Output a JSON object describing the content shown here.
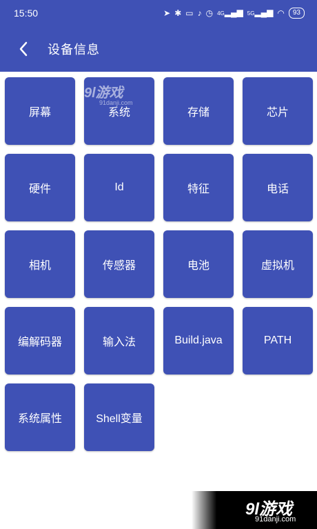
{
  "status_bar": {
    "time": "15:50",
    "signal_1": "4G",
    "signal_2": "5G",
    "battery": "93"
  },
  "toolbar": {
    "title": "设备信息"
  },
  "tiles": [
    "屏幕",
    "系统",
    "存储",
    "芯片",
    "硬件",
    "Id",
    "特征",
    "电话",
    "相机",
    "传感器",
    "电池",
    "虚拟机",
    "编解码器",
    "输入法",
    "Build.java",
    "PATH",
    "系统属性",
    "Shell变量"
  ],
  "watermark": {
    "logo": "9l游戏",
    "site": "91danji.com"
  },
  "colors": {
    "primary": "#3f51b5",
    "background": "#ffffff"
  }
}
